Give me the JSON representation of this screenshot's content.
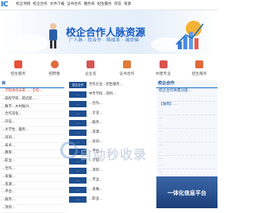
{
  "site": {
    "logo_text": "IC"
  },
  "topnav": [
    "校企项目",
    "校企合作",
    "文件下载",
    "证书合作",
    "服务商",
    "招生服务",
    "问答",
    "资源"
  ],
  "banner": {
    "title": "校企合作人脉资源",
    "subtitle": "广人脉 · 找合作 · 降成本 · 减烦恼"
  },
  "iconrow": [
    {
      "label": "招生服务",
      "icon": "bag-icon",
      "color": "#e8503a"
    },
    {
      "label": "招聘者",
      "icon": "user-icon",
      "color": "#e06a3b"
    },
    {
      "label": "企业名",
      "icon": "building-icon",
      "color": "#d65454"
    },
    {
      "label": "证书合作",
      "icon": "certificate-icon",
      "color": "#e07b39"
    },
    {
      "label": "共建专业",
      "icon": "book-icon",
      "color": "#d9534f"
    },
    {
      "label": "招生服务",
      "icon": "grid-icon",
      "color": "#e0693a"
    }
  ],
  "left": {
    "heading": "目",
    "items": [
      {
        "text": "…学院共创未来……全校…",
        "red": true
      },
      {
        "text": "…高校学校…新启航……",
        "red": false
      },
      {
        "text": "…数字…乡村振兴…",
        "red": false
      },
      {
        "text": "…合作深化…",
        "red": false
      },
      {
        "text": "…开设…",
        "red": false
      },
      {
        "text": "…大学生…服务…",
        "red": false
      },
      {
        "text": "…培训…",
        "red": false
      },
      {
        "text": "…技术…",
        "red": false
      },
      {
        "text": "…教育…",
        "red": false
      },
      {
        "text": "…职业…",
        "red": false
      },
      {
        "text": "…合作…",
        "red": false
      },
      {
        "text": "…发展…",
        "red": false
      },
      {
        "text": "…资源…",
        "red": false
      },
      {
        "text": "…平台…",
        "red": false
      },
      {
        "text": "…服务…",
        "red": false
      },
      {
        "text": "…项目…",
        "red": false
      }
    ]
  },
  "mid": {
    "items": [
      {
        "tag": "招生合作",
        "text": "合作企业…招生服务…"
      },
      {
        "tag": "…",
        "text": "中专学校…项目…"
      },
      {
        "tag": "…",
        "text": "…合作…"
      },
      {
        "tag": "…",
        "text": "…企业…"
      },
      {
        "tag": "…",
        "text": "…服务…"
      },
      {
        "tag": "…",
        "text": "…资源…"
      },
      {
        "tag": "…",
        "text": "…培训…"
      },
      {
        "tag": "…",
        "text": "…平台…"
      },
      {
        "tag": "…",
        "text": "…学院…"
      },
      {
        "tag": "…",
        "text": "…项目…"
      },
      {
        "tag": "…",
        "text": "…专业…"
      },
      {
        "tag": "…",
        "text": "…发展…"
      },
      {
        "tag": "…",
        "text": "…职业…"
      }
    ]
  },
  "right": {
    "heading": "校企合作",
    "items": [
      {
        "t1": "校企合作供需对接…",
        "t2": "…"
      },
      {
        "t1": "【湖南】…",
        "t2": "…"
      },
      {
        "t1": "…",
        "t2": "…"
      },
      {
        "t1": "…",
        "t2": "…"
      },
      {
        "t1": "…",
        "t2": "…"
      },
      {
        "t1": "…",
        "t2": "…"
      },
      {
        "t1": "…",
        "t2": "…"
      }
    ],
    "promo_title": "一体化信息平台"
  },
  "watermark": {
    "main": "自动秒收录",
    "sub": "…"
  }
}
